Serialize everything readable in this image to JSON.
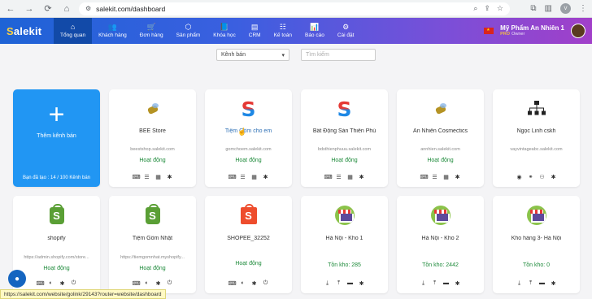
{
  "browser": {
    "url": "salekit.com/dashboard",
    "profile_initial": "V"
  },
  "header": {
    "logo": "alekit",
    "logo_s": "S",
    "menu": [
      {
        "label": "Tổng quan",
        "icon": "home-icon"
      },
      {
        "label": "Khách hàng",
        "icon": "users-icon"
      },
      {
        "label": "Đơn hàng",
        "icon": "cart-icon"
      },
      {
        "label": "Sản phẩm",
        "icon": "box-icon"
      },
      {
        "label": "Khóa học",
        "icon": "book-icon"
      },
      {
        "label": "CRM",
        "icon": "crm-icon"
      },
      {
        "label": "Kế toán",
        "icon": "calculator-icon"
      },
      {
        "label": "Báo cáo",
        "icon": "chart-icon"
      },
      {
        "label": "Cài đặt",
        "icon": "gear-icon"
      }
    ],
    "user_name": "Mỹ Phẩm An Nhiên 1",
    "user_badge": "PRO",
    "user_role": "Owner"
  },
  "filters": {
    "channel_select": "Kênh bán",
    "search_placeholder": "Tìm kiếm"
  },
  "add_card": {
    "label": "Thêm kênh bán",
    "quota": "Bạn đã tạo : 14 / 100 Kênh bán"
  },
  "channels_row1": [
    {
      "title": "BEE Store",
      "domain": "beestshop.salekit.com",
      "status": "Hoạt động",
      "icon": "bee-icon"
    },
    {
      "title": "Tiệm Gốm cho em",
      "domain": "gomchoem.salekit.com",
      "status": "Hoạt động",
      "icon": "salekit-s-icon"
    },
    {
      "title": "Bất Động Sản Thiên Phú",
      "domain": "bdsthienphuuu.salekit.com",
      "status": "Hoạt động",
      "icon": "salekit-s-icon"
    },
    {
      "title": "An Nhiên Cosmectics",
      "domain": "annhien.salekit.com",
      "status": "Hoạt động",
      "icon": "bee-icon"
    },
    {
      "title": "Ngọc Linh cskh",
      "domain": "vayvintageabc.salekit.com",
      "status": "",
      "icon": "org-chart-icon"
    }
  ],
  "channels_row2": [
    {
      "title": "shopify",
      "domain": "https://admin.shopify.com/store...",
      "status": "Hoạt động",
      "icon": "shopify-icon"
    },
    {
      "title": "Tiệm Gốm Nhật",
      "domain": "https://tiemgomnhat.myshopify...",
      "status": "Hoạt động",
      "icon": "shopify-icon"
    },
    {
      "title": "SHOPEE_32252",
      "domain": "",
      "status": "Hoạt động",
      "icon": "shopee-icon"
    },
    {
      "title": "Hà Nội - Kho 1",
      "stock": "Tồn kho: 285",
      "icon": "store-icon"
    },
    {
      "title": "Hà Nội - Kho 2",
      "stock": "Tồn kho: 2442",
      "icon": "store-icon"
    },
    {
      "title": "Kho hàng 3- Hà Nội",
      "stock": "Tồn kho: 0",
      "icon": "store-icon"
    }
  ],
  "status_bar": "https://salekit.com/website/golink/29143?router=website/dashboard"
}
